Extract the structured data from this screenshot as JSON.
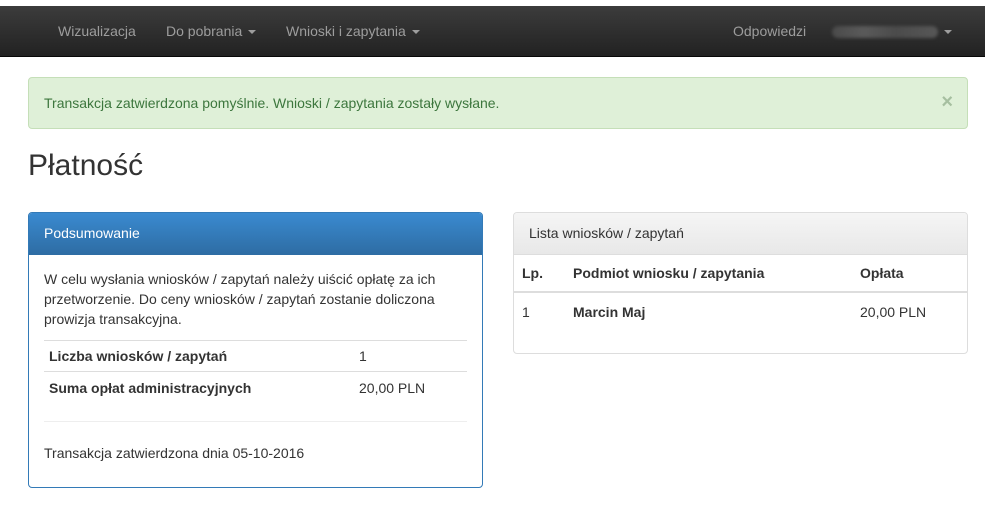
{
  "navbar": {
    "items": [
      {
        "label": "Wizualizacja"
      },
      {
        "label": "Do pobrania"
      },
      {
        "label": "Wnioski i zapytania"
      }
    ],
    "right": {
      "responses_label": "Odpowiedzi"
    }
  },
  "alert": {
    "message": "Transakcja zatwierdzona pomyślnie. Wnioski / zapytania zostały wysłane.",
    "close": "×"
  },
  "page": {
    "title": "Płatność"
  },
  "summary": {
    "heading": "Podsumowanie",
    "description": "W celu wysłania wniosków / zapytań należy uiścić opłatę za ich przetworzenie. Do ceny wniosków / zapytań zostanie doliczona prowizja transakcyjna.",
    "rows": [
      {
        "label": "Liczba wniosków / zapytań",
        "value": "1"
      },
      {
        "label": "Suma opłat administracyjnych",
        "value": "20,00 PLN"
      }
    ],
    "confirmation": "Transakcja zatwierdzona dnia 05-10-2016"
  },
  "list": {
    "heading": "Lista wniosków / zapytań",
    "columns": [
      "Lp.",
      "Podmiot wniosku / zapytania",
      "Opłata"
    ],
    "rows": [
      {
        "lp": "1",
        "subject": "Marcin Maj",
        "fee": "20,00 PLN"
      }
    ]
  }
}
